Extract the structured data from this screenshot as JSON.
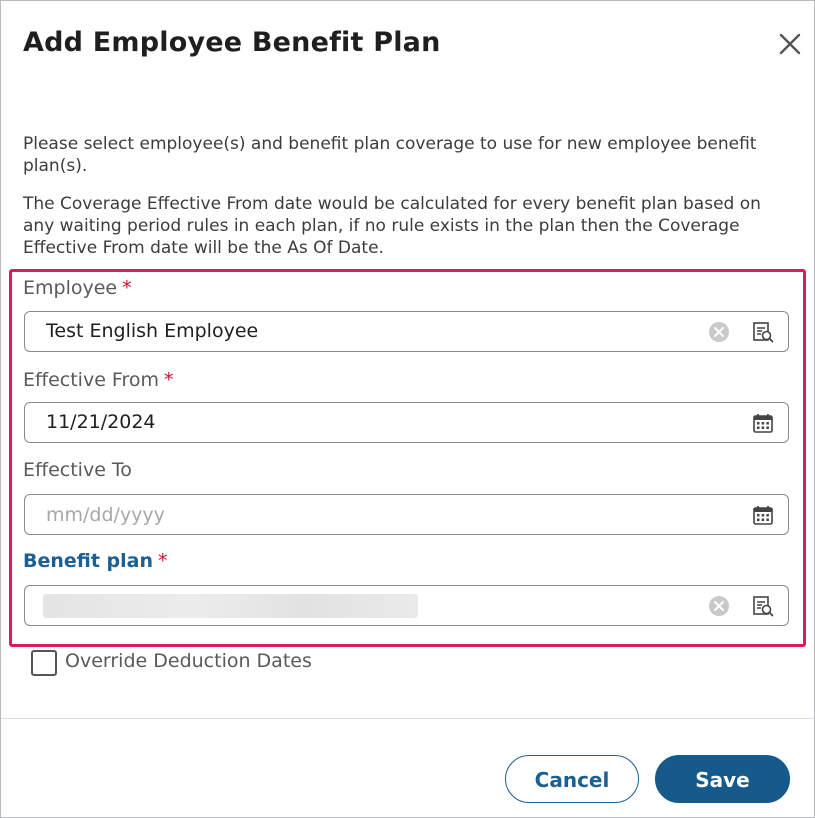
{
  "dialog": {
    "title": "Add Employee Benefit Plan",
    "intro_1": "Please select employee(s) and benefit plan coverage to use for new employee benefit plan(s).",
    "intro_2": "The Coverage Effective From date would be calculated for every benefit plan based on any waiting period rules in each plan, if no rule exists in the plan then the Coverage Effective From date will be the As Of Date."
  },
  "form": {
    "employee": {
      "label": "Employee",
      "required": "*",
      "value": "Test English Employee"
    },
    "effective_from": {
      "label": "Effective From",
      "required": "*",
      "value": "11/21/2024"
    },
    "effective_to": {
      "label": "Effective To",
      "placeholder": "mm/dd/yyyy"
    },
    "benefit_plan": {
      "label": "Benefit plan",
      "required": "*"
    },
    "override": {
      "label": "Override Deduction Dates",
      "checked": false
    }
  },
  "actions": {
    "cancel_label": "Cancel",
    "save_label": "Save"
  },
  "colors": {
    "accent": "#155a8a",
    "highlight": "#e0185e",
    "required": "#c8102e"
  },
  "icons": [
    "close-icon",
    "clear-icon",
    "lookup-icon",
    "calendar-icon"
  ]
}
